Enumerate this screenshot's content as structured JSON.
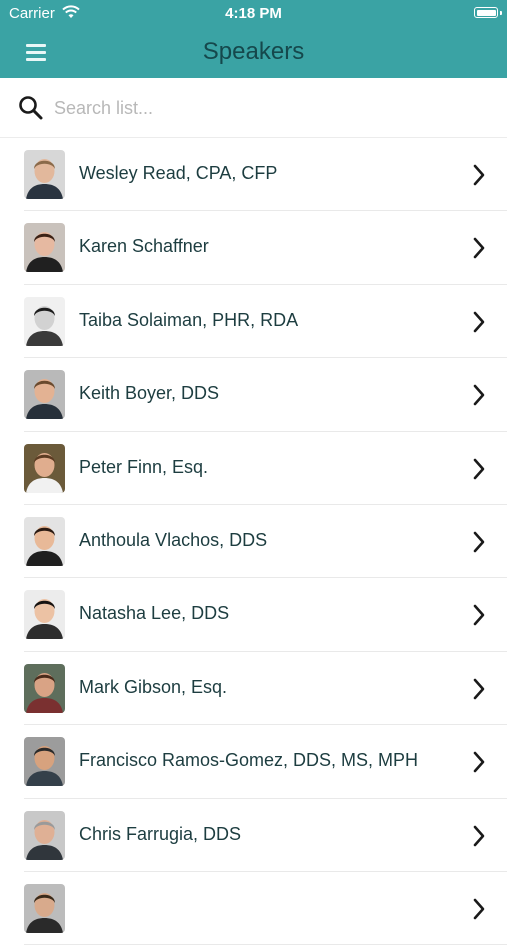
{
  "status_bar": {
    "carrier": "Carrier",
    "time": "4:18 PM"
  },
  "header": {
    "title": "Speakers",
    "menu_icon": "menu-icon"
  },
  "search": {
    "placeholder": "Search list...",
    "value": "",
    "icon": "search-icon"
  },
  "speakers": [
    {
      "name": "Wesley Read, CPA, CFP",
      "skin": "#e2b89c",
      "hair": "#8a6a4a",
      "bg": "#d7d7d7",
      "shirt": "#2a3440"
    },
    {
      "name": "Karen Schaffner",
      "skin": "#e6b9a1",
      "hair": "#3b2216",
      "bg": "#c9c2bc",
      "shirt": "#202020"
    },
    {
      "name": "Taiba Solaiman, PHR, RDA",
      "skin": "#d2d2d2",
      "hair": "#1d1d1d",
      "bg": "#f0f0f0",
      "shirt": "#3a3a3a"
    },
    {
      "name": "Keith Boyer, DDS",
      "skin": "#e3b293",
      "hair": "#6a4a2e",
      "bg": "#b9b9b9",
      "shirt": "#27303a"
    },
    {
      "name": "Peter Finn, Esq.",
      "skin": "#e0ad8e",
      "hair": "#5b3b22",
      "bg": "#6b5a3a",
      "shirt": "#f1f1f1"
    },
    {
      "name": "Anthoula Vlachos, DDS",
      "skin": "#e8b998",
      "hair": "#2a1a12",
      "bg": "#e3e3e3",
      "shirt": "#1f1f1f"
    },
    {
      "name": "Natasha Lee, DDS",
      "skin": "#ecc2a4",
      "hair": "#161210",
      "bg": "#ececec",
      "shirt": "#2d2d2d"
    },
    {
      "name": "Mark Gibson, Esq.",
      "skin": "#d9a385",
      "hair": "#4a2a1a",
      "bg": "#5e6e5c",
      "shirt": "#7a3030"
    },
    {
      "name": "Francisco Ramos-Gomez, DDS, MS, MPH",
      "skin": "#d7a27e",
      "hair": "#2a2a2a",
      "bg": "#9c9c9c",
      "shirt": "#34404a"
    },
    {
      "name": "Chris Farrugia, DDS",
      "skin": "#dfb095",
      "hair": "#9a9a9a",
      "bg": "#c8c8c8",
      "shirt": "#30363c"
    },
    {
      "name": "",
      "skin": "#d8aa8c",
      "hair": "#3a2a1a",
      "bg": "#bcbcbc",
      "shirt": "#2a2a2a"
    }
  ],
  "colors": {
    "header_bg": "#3aa3a4",
    "title": "#15484c",
    "name_text": "#1d3d40"
  }
}
